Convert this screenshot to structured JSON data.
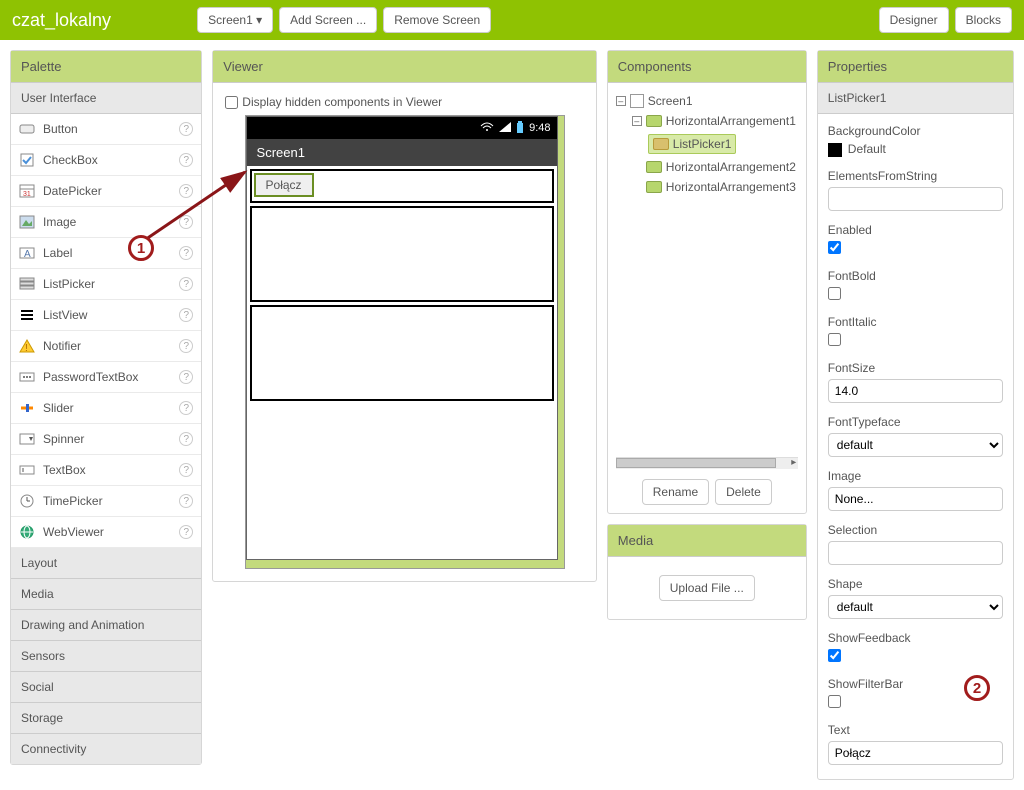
{
  "topbar": {
    "title": "czat_lokalny",
    "screen_button": "Screen1",
    "add_screen": "Add Screen ...",
    "remove_screen": "Remove Screen",
    "designer": "Designer",
    "blocks": "Blocks"
  },
  "palette": {
    "header": "Palette",
    "sub": "User Interface",
    "items": [
      {
        "label": "Button"
      },
      {
        "label": "CheckBox"
      },
      {
        "label": "DatePicker"
      },
      {
        "label": "Image"
      },
      {
        "label": "Label"
      },
      {
        "label": "ListPicker"
      },
      {
        "label": "ListView"
      },
      {
        "label": "Notifier"
      },
      {
        "label": "PasswordTextBox"
      },
      {
        "label": "Slider"
      },
      {
        "label": "Spinner"
      },
      {
        "label": "TextBox"
      },
      {
        "label": "TimePicker"
      },
      {
        "label": "WebViewer"
      }
    ],
    "categories": [
      "Layout",
      "Media",
      "Drawing and Animation",
      "Sensors",
      "Social",
      "Storage",
      "Connectivity"
    ]
  },
  "viewer": {
    "header": "Viewer",
    "chk_label": "Display hidden components in Viewer",
    "status_time": "9:48",
    "appbar": "Screen1",
    "listpicker_text": "Połącz"
  },
  "components": {
    "header": "Components",
    "tree": {
      "root": "Screen1",
      "ha1": "HorizontalArrangement1",
      "lp1": "ListPicker1",
      "ha2": "HorizontalArrangement2",
      "ha3": "HorizontalArrangement3"
    },
    "rename": "Rename",
    "delete": "Delete"
  },
  "media": {
    "header": "Media",
    "upload": "Upload File ..."
  },
  "properties": {
    "header": "Properties",
    "component": "ListPicker1",
    "bg_label": "BackgroundColor",
    "bg_value": "Default",
    "efs_label": "ElementsFromString",
    "efs_value": "",
    "enabled_label": "Enabled",
    "fontbold_label": "FontBold",
    "fontitalic_label": "FontItalic",
    "fontsize_label": "FontSize",
    "fontsize_value": "14.0",
    "fonttypeface_label": "FontTypeface",
    "fonttypeface_value": "default",
    "image_label": "Image",
    "image_value": "None...",
    "selection_label": "Selection",
    "selection_value": "",
    "shape_label": "Shape",
    "shape_value": "default",
    "showfeedback_label": "ShowFeedback",
    "showfilterbar_label": "ShowFilterBar",
    "text_label": "Text",
    "text_value": "Połącz"
  },
  "annotations": {
    "n1": "1",
    "n2": "2"
  }
}
